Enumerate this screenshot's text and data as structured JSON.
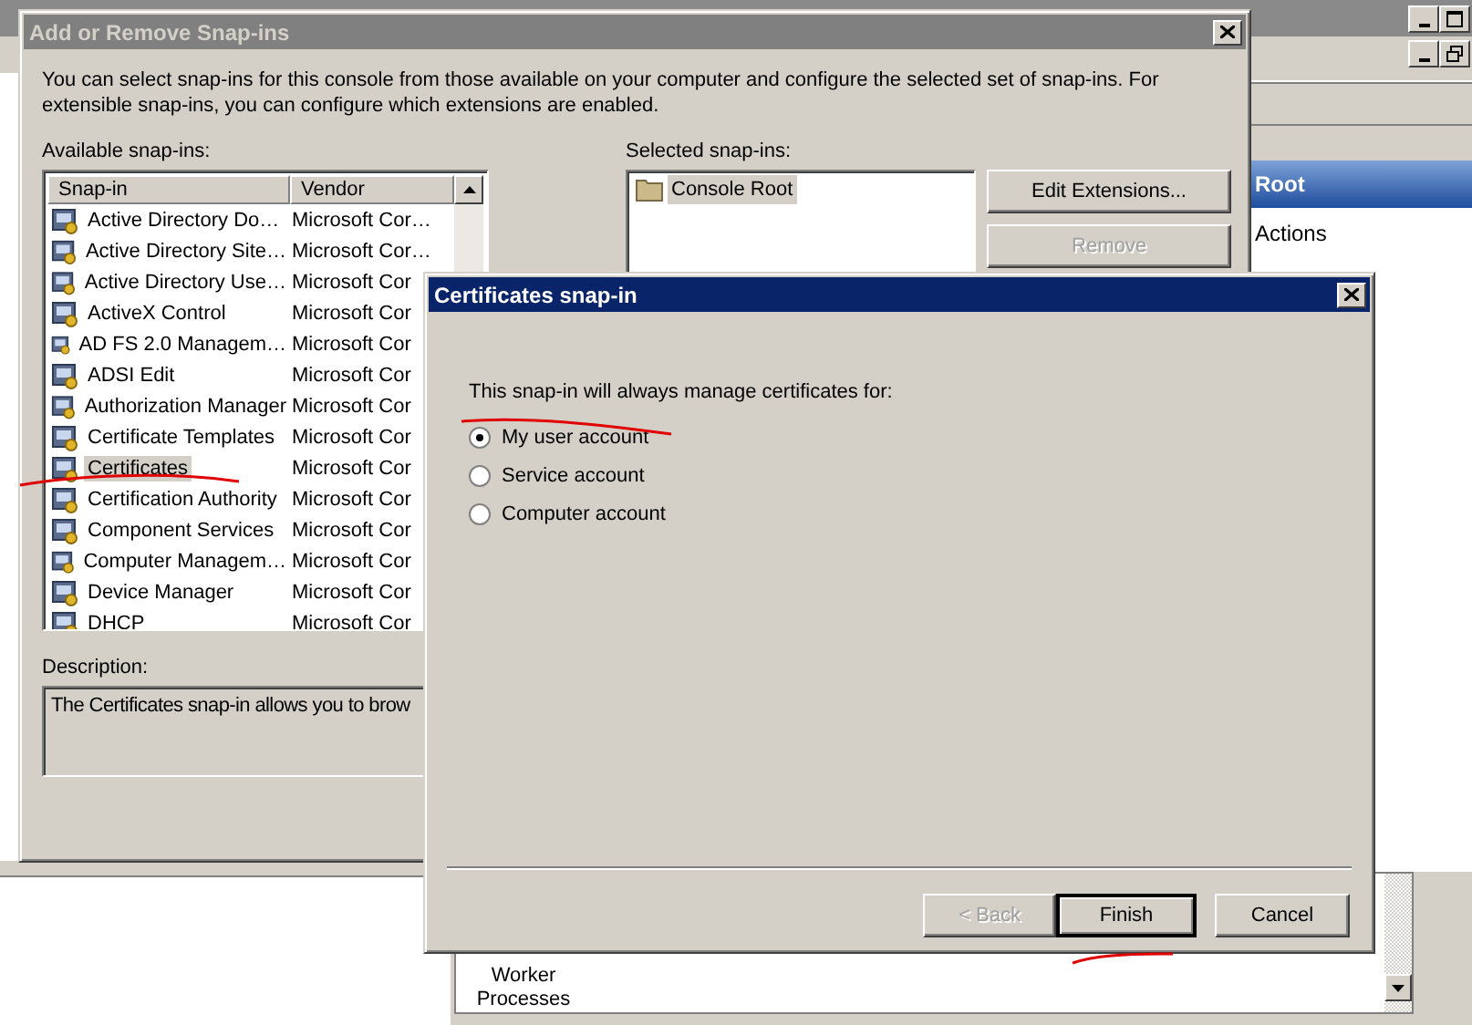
{
  "main_window": {
    "action_pane_title": "Root",
    "actions_label": "Actions",
    "result_pane_item": "Worker Processes"
  },
  "snapins_dialog": {
    "title": "Add or Remove Snap-ins",
    "intro": "You can select snap-ins for this console from those available on your computer and configure the selected set of snap-ins. For\nextensible snap-ins, you can configure which extensions are enabled.",
    "available_label": "Available snap-ins:",
    "columns": [
      "Snap-in",
      "Vendor"
    ],
    "rows": [
      {
        "name": "Active Directory Do…",
        "vendor": "Microsoft Cor…",
        "selected": false
      },
      {
        "name": "Active Directory Site…",
        "vendor": "Microsoft Cor…",
        "selected": false
      },
      {
        "name": "Active Directory Use…",
        "vendor": "Microsoft Cor",
        "selected": false
      },
      {
        "name": "ActiveX Control",
        "vendor": "Microsoft Cor",
        "selected": false
      },
      {
        "name": "AD FS 2.0 Managem…",
        "vendor": "Microsoft Cor",
        "selected": false
      },
      {
        "name": "ADSI Edit",
        "vendor": "Microsoft Cor",
        "selected": false
      },
      {
        "name": "Authorization Manager",
        "vendor": "Microsoft Cor",
        "selected": false
      },
      {
        "name": "Certificate Templates",
        "vendor": "Microsoft Cor",
        "selected": false
      },
      {
        "name": "Certificates",
        "vendor": "Microsoft Cor",
        "selected": true
      },
      {
        "name": "Certification Authority",
        "vendor": "Microsoft Cor",
        "selected": false
      },
      {
        "name": "Component Services",
        "vendor": "Microsoft Cor",
        "selected": false
      },
      {
        "name": "Computer Managem…",
        "vendor": "Microsoft Cor",
        "selected": false
      },
      {
        "name": "Device Manager",
        "vendor": "Microsoft Cor",
        "selected": false
      },
      {
        "name": "DHCP",
        "vendor": "Microsoft Cor",
        "selected": false
      }
    ],
    "description_label": "Description:",
    "description": "The Certificates snap-in allows you to brow",
    "selected_label": "Selected snap-ins:",
    "selected_items": [
      {
        "name": "Console Root",
        "selected": true
      }
    ],
    "buttons": [
      {
        "label": "Edit Extensions...",
        "disabled": false
      },
      {
        "label": "Remove",
        "disabled": true
      }
    ]
  },
  "certificates_dialog": {
    "title": "Certificates snap-in",
    "prompt": "This snap-in will always manage certificates for:",
    "options": [
      {
        "label": "My user account",
        "selected": true
      },
      {
        "label": "Service account",
        "selected": false
      },
      {
        "label": "Computer account",
        "selected": false
      }
    ],
    "buttons": [
      {
        "label": "< Back",
        "disabled": true,
        "default": false
      },
      {
        "label": "Finish",
        "disabled": false,
        "default": true
      },
      {
        "label": "Cancel",
        "disabled": false,
        "default": false
      }
    ]
  }
}
